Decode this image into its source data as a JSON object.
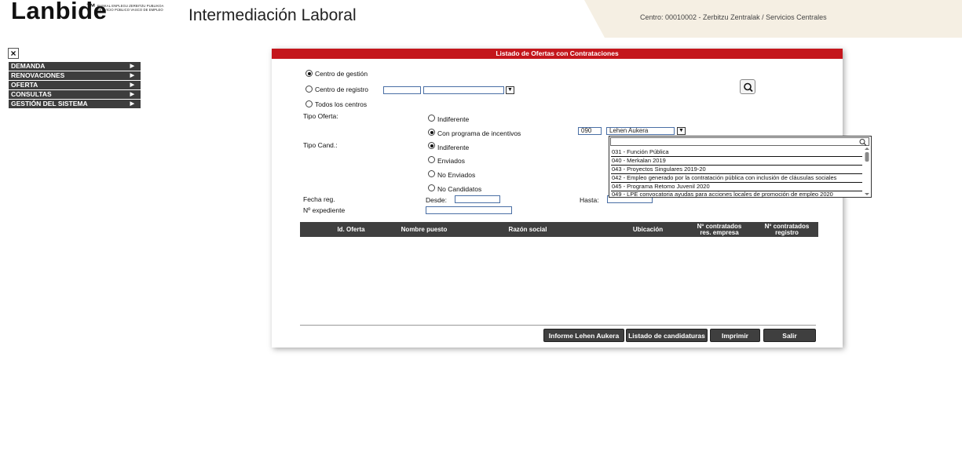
{
  "header": {
    "logo": "Lanbide",
    "logo_tag_line1": "EUSKAL ENPLEGU ZERBITZU PUBLIKOA",
    "logo_tag_line2": "SERVICIO PÚBLICO VASCO DE EMPLEO",
    "app_title": "Intermediación Laboral",
    "centro": "Centro: 00010002 - Zerbitzu Zentralak / Servicios Centrales"
  },
  "sidebar": {
    "close": "×",
    "items": [
      {
        "label": "DEMANDA"
      },
      {
        "label": "RENOVACIONES"
      },
      {
        "label": "OFERTA"
      },
      {
        "label": "CONSULTAS"
      },
      {
        "label": "GESTIÓN DEL SISTEMA"
      }
    ]
  },
  "panel": {
    "title": "Listado de Ofertas con Contrataciones",
    "centro_options": {
      "gestion": "Centro de gestión",
      "registro": "Centro de registro",
      "todos": "Todos los centros"
    },
    "tipo_oferta": {
      "label": "Tipo Oferta:",
      "indiferente": "Indiferente",
      "con_programa": "Con programa de incentivos",
      "program_code": "090",
      "program_name": "Lehen Aukera"
    },
    "tipo_cand": {
      "label": "Tipo Cand.:",
      "indiferente": "Indiferente",
      "enviados": "Enviados",
      "no_enviados": "No Enviados",
      "no_candidatos": "No Candidatos"
    },
    "fecha": {
      "label": "Fecha reg.",
      "desde": "Desde:",
      "hasta": "Hasta:"
    },
    "expediente_label": "Nº expediente",
    "dropdown_options": [
      "031 - Función Pública",
      "040 - Merkalan 2019",
      "043 - Proyectos Singulares 2019-20",
      "042 - Empleo generado por la contratación pública con inclusión de cláusulas sociales",
      "045 - Programa Retomo Juvenil 2020",
      "049 - LPE convocatoria ayudas para acciones locales de promoción de empleo 2020"
    ],
    "table": {
      "columns": [
        "Id. Oferta",
        "Nombre puesto",
        "Razón social",
        "Ubicación",
        "Nº contratados res. empresa",
        "Nº contratados registro"
      ]
    },
    "buttons": {
      "informe": "Informe Lehen Aukera",
      "listado": "Listado de candidaturas",
      "imprimir": "Imprimir",
      "salir": "Salir"
    }
  },
  "colors": {
    "brand_red": "#c4161c",
    "dark_bar": "#3f3f3f",
    "header_beige": "#f5efe3"
  }
}
